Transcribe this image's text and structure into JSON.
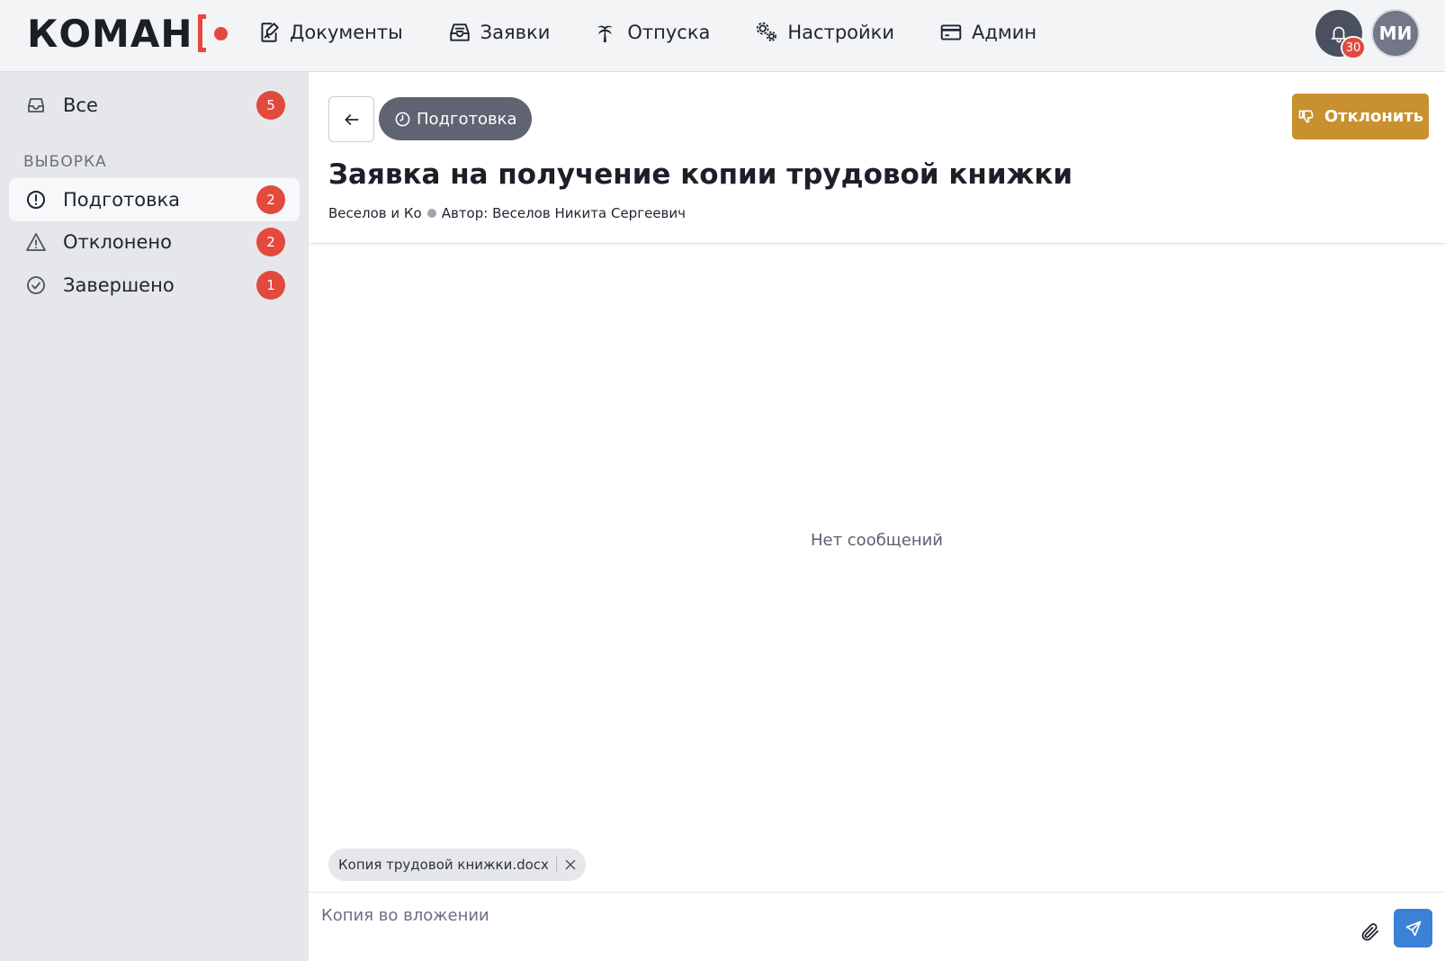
{
  "header": {
    "logo_text": "КОМАН",
    "nav": [
      {
        "label": "Документы",
        "icon": "document-edit-icon"
      },
      {
        "label": "Заявки",
        "icon": "inbox-icon"
      },
      {
        "label": "Отпуска",
        "icon": "palm-tree-icon"
      },
      {
        "label": "Настройки",
        "icon": "gears-icon"
      },
      {
        "label": "Админ",
        "icon": "card-icon"
      }
    ],
    "notifications_count": "30",
    "avatar_initials": "МИ"
  },
  "sidebar": {
    "all": {
      "label": "Все",
      "count": "5"
    },
    "section_title": "ВЫБОРКА",
    "items": [
      {
        "label": "Подготовка",
        "count": "2",
        "active": true
      },
      {
        "label": "Отклонено",
        "count": "2",
        "active": false
      },
      {
        "label": "Завершено",
        "count": "1",
        "active": false
      }
    ]
  },
  "request": {
    "status": "Подготовка",
    "reject_label": "Отклонить",
    "title": "Заявка на получение копии трудовой книжки",
    "company": "Веселов и Ко",
    "author": "Автор: Веселов Никита Сергеевич"
  },
  "messages": {
    "empty_text": "Нет сообщений"
  },
  "composer": {
    "attachment_name": "Копия трудовой книжки.docx",
    "value": "",
    "placeholder": "Копия во вложении"
  },
  "colors": {
    "brand_red": "#e24a3d",
    "reject": "#c8902e",
    "send": "#3b82d6",
    "status_pill": "#5f6472"
  }
}
